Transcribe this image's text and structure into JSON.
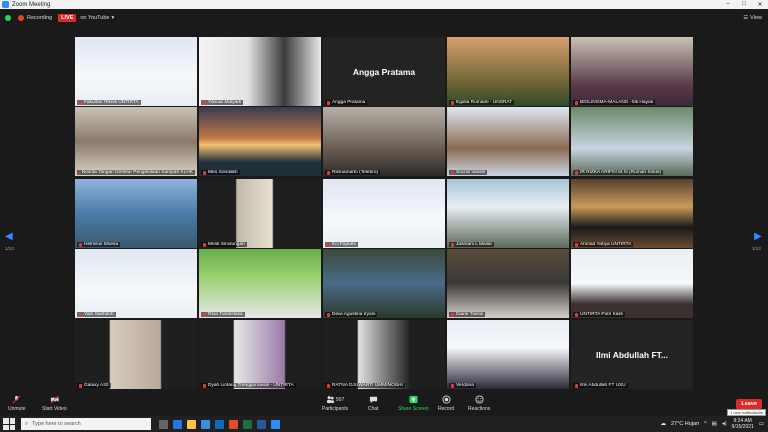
{
  "window": {
    "title": "Zoom Meeting"
  },
  "topbar": {
    "recording_label": "Recording",
    "live_label": "LIVE",
    "youtube_label": "on YouTube",
    "view_label": "View"
  },
  "pagination": {
    "left_page": "1/13",
    "right_page": "1/13"
  },
  "tiles": [
    {
      "name": "Fakultas Teknik UNTIRTA",
      "video": "slide-ui"
    },
    {
      "name": "Yanuar Mulyadi",
      "video": "person-slide"
    },
    {
      "name": "Angga Pratama",
      "video": "name-only",
      "big": "Angga Pratama"
    },
    {
      "name": "Egidia Rumanti - UNSRAT",
      "video": "person-outdoor"
    },
    {
      "name": "BIOLINGMA-MALANG -Siti Hayati",
      "video": "person-hijab-dark"
    },
    {
      "name": "Novrita Tarigan Direktur Pengelolaan Sampah KLHK",
      "video": "person-office"
    },
    {
      "name": "Meo Sondakh",
      "video": "sunset"
    },
    {
      "name": "Rismamarto (Telebro)",
      "video": "persons-indoor"
    },
    {
      "name": "Socrat Vassel",
      "video": "person-slide-blue"
    },
    {
      "name": "IR RIZKA ARIFIN M.Si (Rumah Sirkel)",
      "video": "person-hijab-light"
    },
    {
      "name": "Helmilus Moesa",
      "video": "harbor"
    },
    {
      "name": "Meldi Sinolungan",
      "video": "person-curtain"
    },
    {
      "name": "Eci Fajriani",
      "video": "slide-ui"
    },
    {
      "name": "Jasmani L Mailal",
      "video": "person-building"
    },
    {
      "name": "Ahmad Yahya UNTIRTA",
      "video": "person-balcony"
    },
    {
      "name": "Yani Saefuloh",
      "video": "slide-ui"
    },
    {
      "name": "Rina Tumbelaka",
      "video": "person-garden"
    },
    {
      "name": "Dewi Agustina Iryani",
      "video": "garden-house"
    },
    {
      "name": "Diane Tiwow",
      "video": "room-mirror"
    },
    {
      "name": "UNTIRTA Putri Kalis",
      "video": "person-slide-light"
    },
    {
      "name": "Galaxy A20",
      "video": "room-door"
    },
    {
      "name": "Dyah Lintang Trenggonowati - UNTIRTA",
      "video": "slide-flower"
    },
    {
      "name": "RATNA DJUWARTI UMMINOSHI",
      "video": "person-bookshelf"
    },
    {
      "name": "Verdona",
      "video": "person-slide-hijab"
    },
    {
      "name": "Ilmi Abdullah FT USU",
      "video": "name-only",
      "big": "Ilmi Abdullah FT..."
    }
  ],
  "toolbar": {
    "unmute": "Unmute",
    "start_video": "Start Video",
    "participants": "Participants",
    "participants_count": "507",
    "chat": "Chat",
    "share_screen": "Share Screen",
    "record": "Record",
    "reactions": "Reactions",
    "leave": "Leave",
    "tooltip": "1 new notifications"
  },
  "taskbar": {
    "search_placeholder": "Type here to search",
    "weather": "27°C  Hujan",
    "time": "9:24 AM",
    "date": "9/15/2021"
  },
  "colors": {
    "accent": "#2d8cff",
    "leave": "#e02828",
    "share": "#23d959"
  }
}
